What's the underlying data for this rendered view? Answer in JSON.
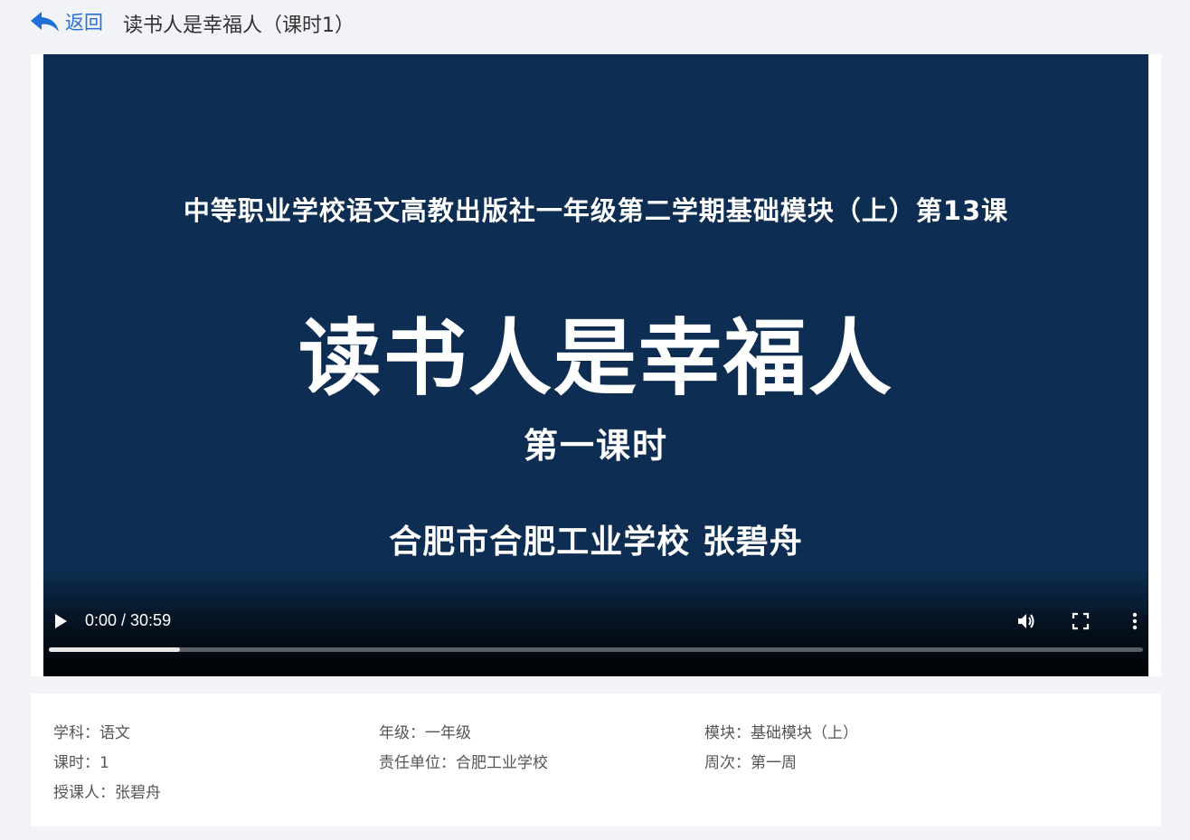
{
  "header": {
    "back_label": "返回",
    "title": "读书人是幸福人（课时1）"
  },
  "video": {
    "slide": {
      "line1": "中等职业学校语文高教出版社一年级第二学期基础模块（上）第13课",
      "title": "读书人是幸福人",
      "subtitle": "第一课时",
      "author": "合肥市合肥工业学校  张碧舟"
    },
    "time_display": "0:00 / 30:59",
    "buffered_fraction": 0.12
  },
  "info": {
    "subject": "学科：语文",
    "grade": "年级：一年级",
    "module": "模块：基础模块（上）",
    "lesson": "课时：1",
    "unit": "责任单位：合肥工业学校",
    "week": "周次：第一周",
    "teacher": "授课人：张碧舟"
  },
  "colors": {
    "accent": "#1f6fd6",
    "slide_background": "#0d2e52",
    "page_background": "#f1f3f7"
  },
  "icons": {
    "back": "back-arrow-icon",
    "play": "play-icon",
    "volume": "volume-icon",
    "fullscreen": "fullscreen-icon",
    "more": "more-vertical-icon"
  }
}
